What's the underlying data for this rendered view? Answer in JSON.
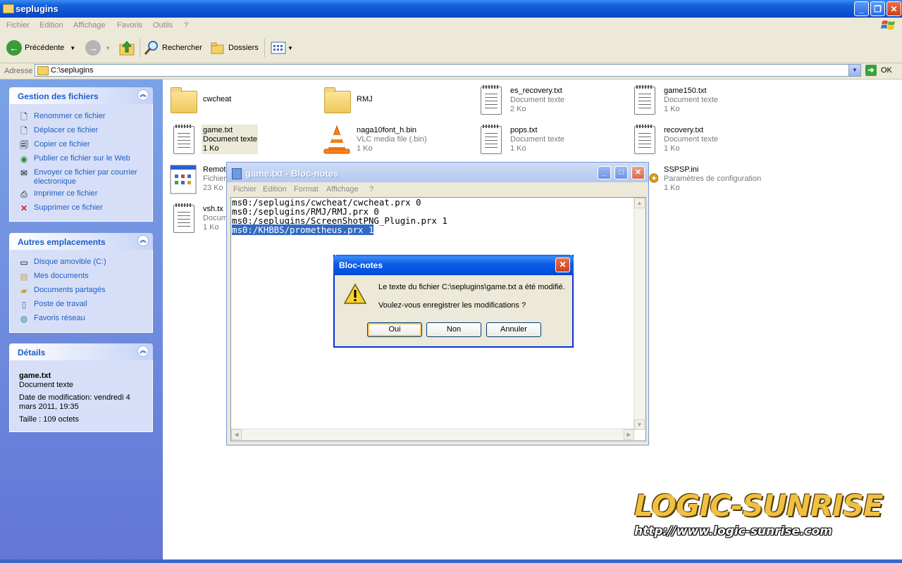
{
  "explorer": {
    "title": "seplugins",
    "menu": [
      "Fichier",
      "Edition",
      "Affichage",
      "Favoris",
      "Outils",
      "?"
    ],
    "toolbar": {
      "back_label": "Précédente",
      "search_label": "Rechercher",
      "folders_label": "Dossiers"
    },
    "address": {
      "label": "Adresse",
      "value": "C:\\seplugins",
      "go_label": "OK"
    }
  },
  "left_pane": {
    "file_tasks": {
      "header": "Gestion des fichiers",
      "items": [
        {
          "label": "Renommer ce fichier",
          "icon": "rename-icon"
        },
        {
          "label": "Déplacer ce fichier",
          "icon": "move-icon"
        },
        {
          "label": "Copier ce fichier",
          "icon": "copy-icon"
        },
        {
          "label": "Publier ce fichier sur le Web",
          "icon": "publish-icon"
        },
        {
          "label": "Envoyer ce fichier par courrier électronique",
          "icon": "email-icon"
        },
        {
          "label": "Imprimer ce fichier",
          "icon": "printer-icon"
        },
        {
          "label": "Supprimer ce fichier",
          "icon": "delete-icon"
        }
      ]
    },
    "other_places": {
      "header": "Autres emplacements",
      "items": [
        {
          "label": "Disque amovible (C:)",
          "icon": "drive-icon"
        },
        {
          "label": "Mes documents",
          "icon": "my-documents-icon"
        },
        {
          "label": "Documents partagés",
          "icon": "shared-folder-icon"
        },
        {
          "label": "Poste de travail",
          "icon": "computer-icon"
        },
        {
          "label": "Favoris réseau",
          "icon": "network-icon"
        }
      ]
    },
    "details": {
      "header": "Détails",
      "name": "game.txt",
      "type": "Document texte",
      "modified": "Date de modification: vendredi 4 mars 2011, 19:35",
      "size": "Taille : 109 octets"
    }
  },
  "files": [
    {
      "name": "cwcheat",
      "type": "",
      "size": "",
      "icon": "folder-icon"
    },
    {
      "name": "RMJ",
      "type": "",
      "size": "",
      "icon": "folder-icon"
    },
    {
      "name": "es_recovery.txt",
      "type": "Document texte",
      "size": "2 Ko",
      "icon": "text-document-icon"
    },
    {
      "name": "game150.txt",
      "type": "Document texte",
      "size": "1 Ko",
      "icon": "text-document-icon"
    },
    {
      "name": "game.txt",
      "type": "Document texte",
      "size": "1 Ko",
      "icon": "text-document-icon"
    },
    {
      "name": "naga10font_h.bin",
      "type": "VLC media file (.bin)",
      "size": "1 Ko",
      "icon": "vlc-cone-icon"
    },
    {
      "name": "pops.txt",
      "type": "Document texte",
      "size": "1 Ko",
      "icon": "text-document-icon"
    },
    {
      "name": "recovery.txt",
      "type": "Document texte",
      "size": "1 Ko",
      "icon": "text-document-icon"
    },
    {
      "name": "Remote",
      "type": "Fichier",
      "size": "23 Ko",
      "icon": "application-icon"
    },
    {
      "name": "SSPSP.ini",
      "type": "Paramètres de configuration",
      "size": "1 Ko",
      "icon": "settings-file-icon"
    },
    {
      "name": "vsh.tx",
      "type": "Document",
      "size": "1 Ko",
      "icon": "text-document-icon"
    }
  ],
  "notepad": {
    "title": "game.txt - Bloc-notes",
    "menu": [
      "Fichier",
      "Edition",
      "Format",
      "Affichage",
      "?"
    ],
    "lines": [
      "ms0:/seplugins/cwcheat/cwcheat.prx 0",
      "ms0:/seplugins/RMJ/RMJ.prx 0",
      "ms0:/seplugins/ScreenShotPNG_Plugin.prx 1",
      "ms0:/KHBBS/prometheus.prx 1"
    ]
  },
  "dialog": {
    "title": "Bloc-notes",
    "message1": "Le texte du fichier C:\\seplugins\\game.txt a été modifié.",
    "message2": "Voulez-vous enregistrer les modifications ?",
    "buttons": {
      "yes": "Oui",
      "no": "Non",
      "cancel": "Annuler"
    }
  },
  "watermark": {
    "title": "LOGIC-SUNRISE",
    "url": "http://www.logic-sunrise.com"
  }
}
